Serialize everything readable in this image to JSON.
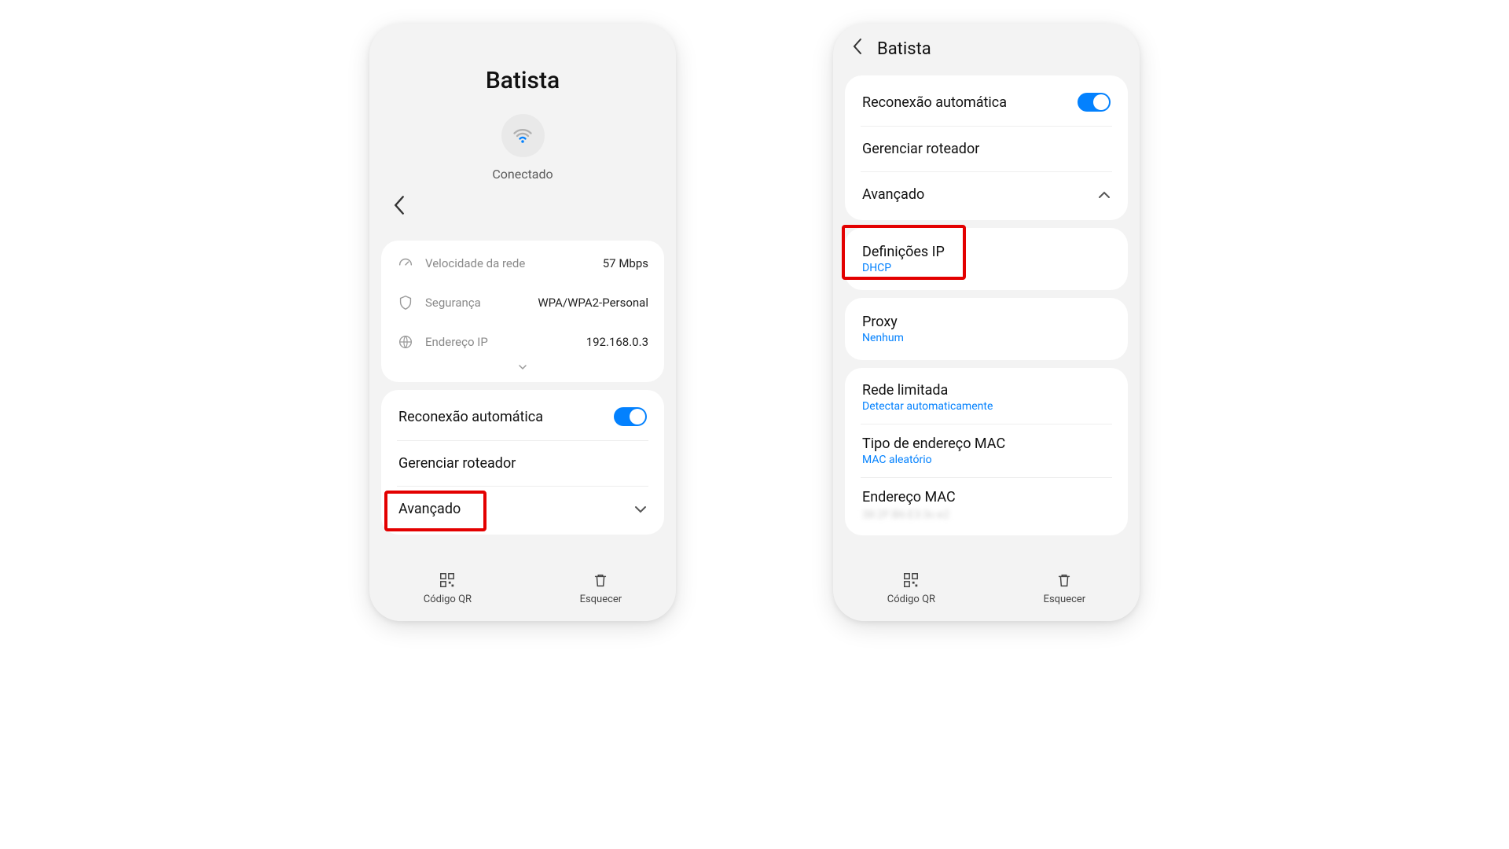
{
  "phone1": {
    "title": "Batista",
    "status": "Conectado",
    "info": {
      "speed_label": "Velocidade da rede",
      "speed_value": "57 Mbps",
      "security_label": "Segurança",
      "security_value": "WPA/WPA2-Personal",
      "ip_label": "Endereço IP",
      "ip_value": "192.168.0.3"
    },
    "settings": {
      "auto_reconnect": "Reconexão automática",
      "manage_router": "Gerenciar roteador",
      "advanced": "Avançado"
    },
    "bottom": {
      "qr": "Código QR",
      "forget": "Esquecer"
    }
  },
  "phone2": {
    "title": "Batista",
    "settings": {
      "auto_reconnect": "Reconexão automática",
      "manage_router": "Gerenciar roteador",
      "advanced": "Avançado",
      "ip_settings": "Definições IP",
      "ip_settings_value": "DHCP",
      "proxy": "Proxy",
      "proxy_value": "Nenhum",
      "metered": "Rede limitada",
      "metered_value": "Detectar automaticamente",
      "mac_type": "Tipo de endereço MAC",
      "mac_type_value": "MAC aleatório",
      "mac_address": "Endereço MAC",
      "mac_address_value": "38:2F:B6:E3:3c:e2"
    },
    "bottom": {
      "qr": "Código QR",
      "forget": "Esquecer"
    }
  }
}
